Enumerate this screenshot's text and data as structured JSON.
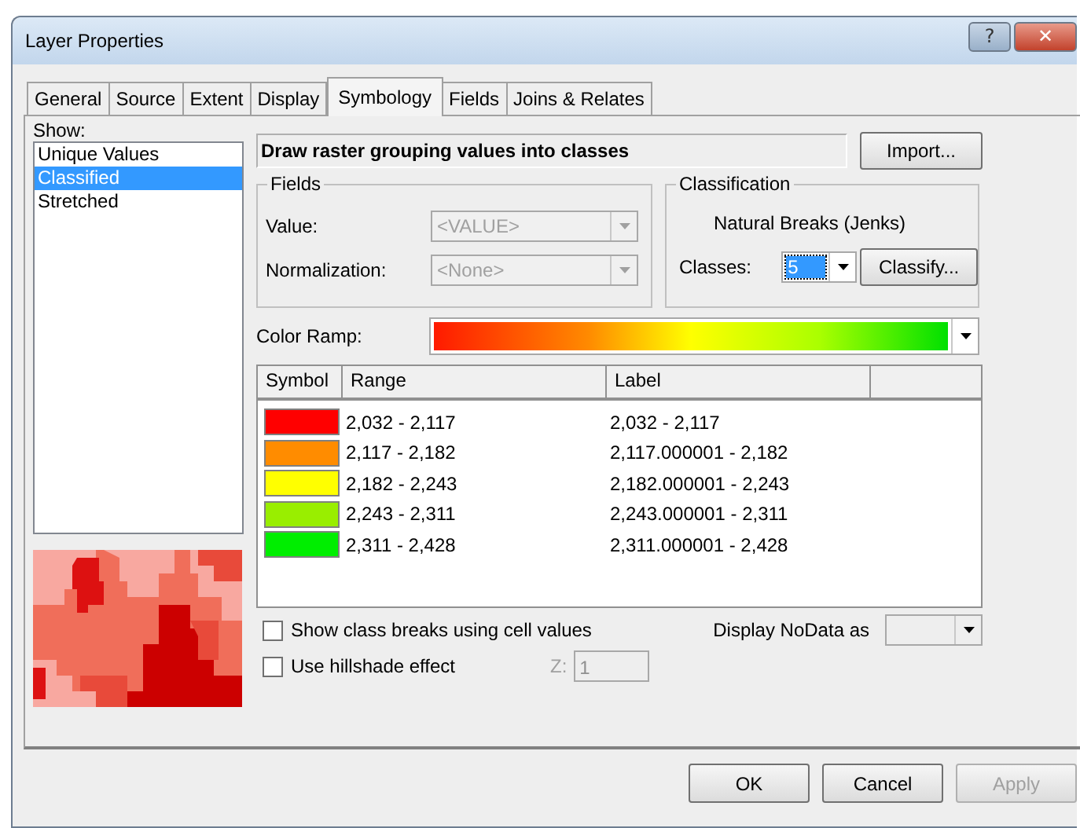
{
  "window": {
    "title": "Layer Properties",
    "help_button": "?",
    "close_button": "✕"
  },
  "tabs": [
    {
      "label": "General",
      "selected": false
    },
    {
      "label": "Source",
      "selected": false
    },
    {
      "label": "Extent",
      "selected": false
    },
    {
      "label": "Display",
      "selected": false
    },
    {
      "label": "Symbology",
      "selected": true
    },
    {
      "label": "Fields",
      "selected": false
    },
    {
      "label": "Joins & Relates",
      "selected": false
    }
  ],
  "show": {
    "label": "Show:",
    "items": [
      {
        "label": "Unique Values",
        "selected": false
      },
      {
        "label": "Classified",
        "selected": true
      },
      {
        "label": "Stretched",
        "selected": false
      }
    ]
  },
  "description": "Draw raster grouping values into classes",
  "import_button": "Import...",
  "fields": {
    "title": "Fields",
    "rows": [
      {
        "label": "Value:",
        "value": "<VALUE>",
        "disabled": true
      },
      {
        "label": "Normalization:",
        "value": "<None>",
        "disabled": true
      }
    ]
  },
  "classification": {
    "title": "Classification",
    "method": "Natural Breaks (Jenks)",
    "classes_label": "Classes:",
    "classes": "5",
    "classify_button": "Classify..."
  },
  "color_ramp": {
    "label": "Color Ramp:"
  },
  "table": {
    "columns": [
      "Symbol",
      "Range",
      "Label"
    ],
    "rows": [
      {
        "color": "#ff0000",
        "range": "2,032 - 2,117",
        "label": "2,032 - 2,117"
      },
      {
        "color": "#ff8c00",
        "range": "2,117 - 2,182",
        "label": "2,117.000001 - 2,182"
      },
      {
        "color": "#ffff00",
        "range": "2,182 - 2,243",
        "label": "2,182.000001 - 2,243"
      },
      {
        "color": "#99ee00",
        "range": "2,243 - 2,311",
        "label": "2,243.000001 - 2,311"
      },
      {
        "color": "#00ee00",
        "range": "2,311 - 2,428",
        "label": "2,311.000001 - 2,428"
      }
    ]
  },
  "options": [
    {
      "label": "Show class breaks using cell values",
      "checked": false
    },
    {
      "label": "Use hillshade effect",
      "checked": false
    }
  ],
  "z_field": {
    "label": "Z:",
    "value": "1",
    "disabled": true
  },
  "nodata": {
    "label": "Display NoData as"
  },
  "buttons": [
    {
      "label": "OK",
      "disabled": false
    },
    {
      "label": "Cancel",
      "disabled": false
    },
    {
      "label": "Apply",
      "disabled": true
    }
  ]
}
